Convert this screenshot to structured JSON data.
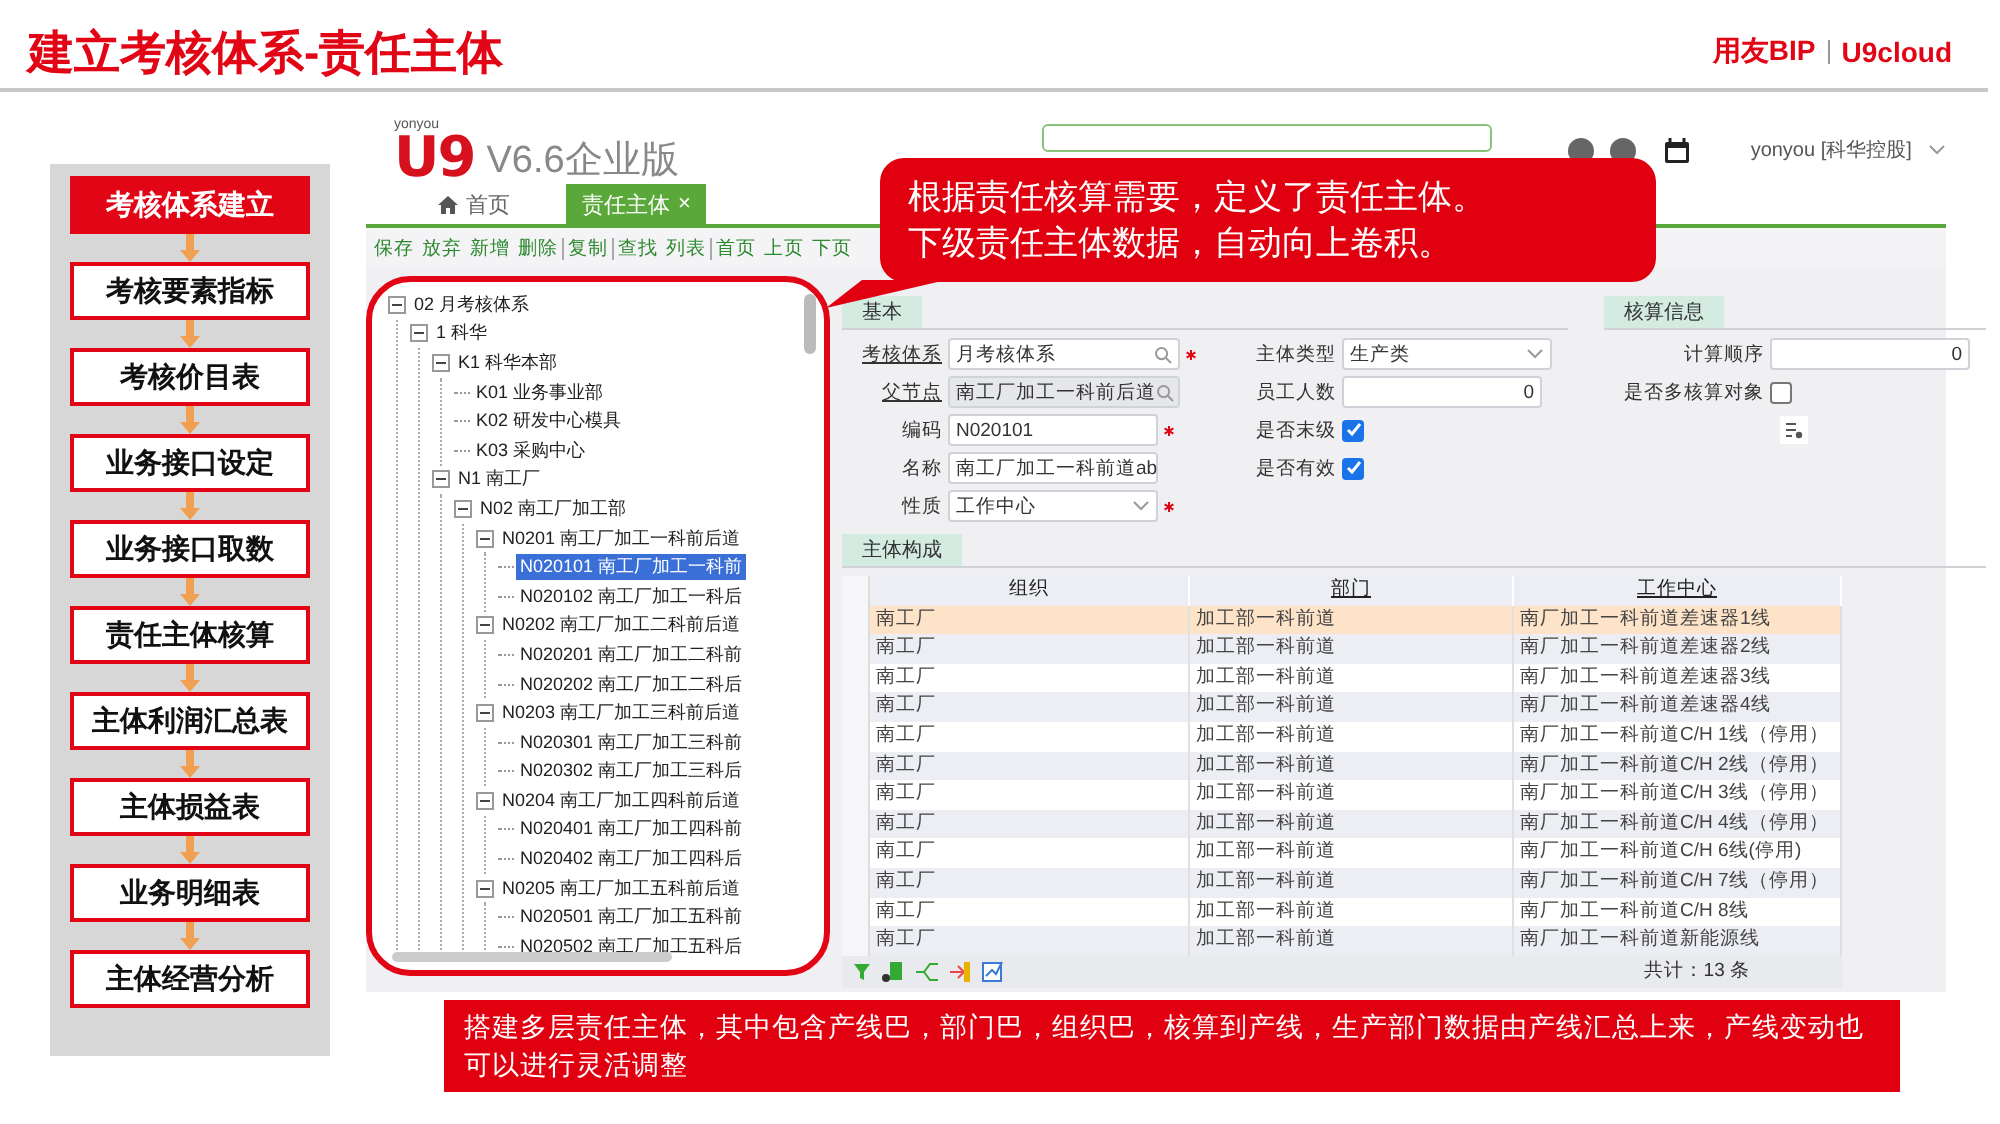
{
  "slide": {
    "title": "建立考核体系-责任主体",
    "brand": {
      "name": "用友BIP",
      "product": "U9cloud"
    }
  },
  "steps": [
    {
      "label": "考核体系建立",
      "selected": true
    },
    {
      "label": "考核要素指标",
      "selected": false
    },
    {
      "label": "考核价目表",
      "selected": false
    },
    {
      "label": "业务接口设定",
      "selected": false
    },
    {
      "label": "业务接口取数",
      "selected": false
    },
    {
      "label": "责任主体核算",
      "selected": false
    },
    {
      "label": "主体利润汇总表",
      "selected": false
    },
    {
      "label": "主体损益表",
      "selected": false
    },
    {
      "label": "业务明细表",
      "selected": false
    },
    {
      "label": "主体经营分析",
      "selected": false
    }
  ],
  "app": {
    "logo": {
      "vendor": "yonyou",
      "mark": "U9",
      "edition": "V6.6企业版"
    },
    "user": "yonyou [科华控股]",
    "tabs": [
      {
        "label": "首页",
        "kind": "home",
        "selected": false
      },
      {
        "label": "责任主体",
        "kind": "doc",
        "selected": true,
        "close": "×"
      }
    ],
    "toolbar": [
      [
        "保存",
        "放弃",
        "新增",
        "删除"
      ],
      [
        "复制"
      ],
      [
        "查找",
        "列表"
      ],
      [
        "首页",
        "上页",
        "下页"
      ]
    ],
    "tree": [
      {
        "label": "02 月考核体系",
        "expanded": true,
        "selected": false,
        "children": [
          {
            "label": "1 科华",
            "expanded": true,
            "selected": false,
            "children": [
              {
                "label": "K1 科华本部",
                "expanded": true,
                "selected": false,
                "children": [
                  {
                    "label": "K01 业务事业部",
                    "selected": false
                  },
                  {
                    "label": "K02 研发中心模具",
                    "selected": false
                  },
                  {
                    "label": "K03 采购中心",
                    "selected": false
                  }
                ]
              },
              {
                "label": "N1 南工厂",
                "expanded": true,
                "selected": false,
                "children": [
                  {
                    "label": "N02 南工厂加工部",
                    "expanded": true,
                    "selected": false,
                    "children": [
                      {
                        "label": "N0201 南工厂加工一科前后道",
                        "expanded": true,
                        "selected": false,
                        "children": [
                          {
                            "label": "N020101 南工厂加工一科前",
                            "selected": true
                          },
                          {
                            "label": "N020102 南工厂加工一科后",
                            "selected": false
                          }
                        ]
                      },
                      {
                        "label": "N0202 南工厂加工二科前后道",
                        "expanded": true,
                        "selected": false,
                        "children": [
                          {
                            "label": "N020201 南工厂加工二科前",
                            "selected": false
                          },
                          {
                            "label": "N020202 南工厂加工二科后",
                            "selected": false
                          }
                        ]
                      },
                      {
                        "label": "N0203 南工厂加工三科前后道",
                        "expanded": true,
                        "selected": false,
                        "children": [
                          {
                            "label": "N020301 南工厂加工三科前",
                            "selected": false
                          },
                          {
                            "label": "N020302 南工厂加工三科后",
                            "selected": false
                          }
                        ]
                      },
                      {
                        "label": "N0204 南工厂加工四科前后道",
                        "expanded": true,
                        "selected": false,
                        "children": [
                          {
                            "label": "N020401 南工厂加工四科前",
                            "selected": false
                          },
                          {
                            "label": "N020402 南工厂加工四科后",
                            "selected": false
                          }
                        ]
                      },
                      {
                        "label": "N0205 南工厂加工五科前后道",
                        "expanded": true,
                        "selected": false,
                        "children": [
                          {
                            "label": "N020501 南工厂加工五科前",
                            "selected": false
                          },
                          {
                            "label": "N020502 南工厂加工五科后",
                            "selected": false
                          }
                        ]
                      }
                    ]
                  }
                ]
              }
            ]
          }
        ]
      }
    ],
    "form": {
      "sections": [
        {
          "title": "基本",
          "columns": [
            [
              {
                "label": "考核体系",
                "kind": "lookup",
                "value": "月考核体系",
                "link": true,
                "required": true,
                "disabled": false
              },
              {
                "label": "父节点",
                "kind": "lookup",
                "value": "南工厂加工一科前后道",
                "link": true,
                "required": false,
                "disabled": true
              },
              {
                "label": "编码",
                "kind": "text",
                "value": "N020101",
                "link": false,
                "required": true,
                "disabled": false
              },
              {
                "label": "名称",
                "kind": "text",
                "value": "南工厂加工一科前道",
                "suffix": "ab",
                "link": false,
                "required": false,
                "disabled": false
              },
              {
                "label": "性质",
                "kind": "select",
                "value": "工作中心",
                "link": false,
                "required": true,
                "disabled": false
              }
            ],
            [
              {
                "label": "主体类型",
                "kind": "select",
                "value": "生产类",
                "link": false,
                "required": false,
                "disabled": false
              },
              {
                "label": "员工人数",
                "kind": "number",
                "value": "0",
                "link": false,
                "required": false,
                "disabled": false
              },
              {
                "label": "是否末级",
                "kind": "checkbox",
                "checked": true
              },
              {
                "label": "是否有效",
                "kind": "checkbox",
                "checked": true
              }
            ]
          ]
        },
        {
          "title": "核算信息",
          "columns": [
            [
              {
                "label": "计算顺序",
                "kind": "number",
                "value": "0",
                "link": false,
                "required": false,
                "disabled": false
              },
              {
                "label": "是否多核算对象",
                "kind": "checkbox",
                "checked": false
              },
              {
                "kind": "tool"
              }
            ]
          ]
        }
      ]
    },
    "grid": {
      "title": "主体构成",
      "columns": [
        {
          "label": "组织",
          "underlined": false
        },
        {
          "label": "部门",
          "underlined": true
        },
        {
          "label": "工作中心",
          "underlined": true
        }
      ],
      "rows": [
        {
          "cells": [
            "南工厂",
            "加工部一科前道",
            "南厂加工一科前道差速器1线"
          ],
          "selected": true
        },
        {
          "cells": [
            "南工厂",
            "加工部一科前道",
            "南厂加工一科前道差速器2线"
          ],
          "selected": false
        },
        {
          "cells": [
            "南工厂",
            "加工部一科前道",
            "南厂加工一科前道差速器3线"
          ],
          "selected": false
        },
        {
          "cells": [
            "南工厂",
            "加工部一科前道",
            "南厂加工一科前道差速器4线"
          ],
          "selected": false
        },
        {
          "cells": [
            "南工厂",
            "加工部一科前道",
            "南厂加工一科前道C/H 1线（停用）"
          ],
          "selected": false
        },
        {
          "cells": [
            "南工厂",
            "加工部一科前道",
            "南厂加工一科前道C/H 2线（停用）"
          ],
          "selected": false
        },
        {
          "cells": [
            "南工厂",
            "加工部一科前道",
            "南厂加工一科前道C/H 3线（停用）"
          ],
          "selected": false
        },
        {
          "cells": [
            "南工厂",
            "加工部一科前道",
            "南厂加工一科前道C/H 4线（停用）"
          ],
          "selected": false
        },
        {
          "cells": [
            "南工厂",
            "加工部一科前道",
            "南厂加工一科前道C/H 6线(停用)"
          ],
          "selected": false
        },
        {
          "cells": [
            "南工厂",
            "加工部一科前道",
            "南厂加工一科前道C/H 7线（停用）"
          ],
          "selected": false
        },
        {
          "cells": [
            "南工厂",
            "加工部一科前道",
            "南厂加工一科前道C/H 8线"
          ],
          "selected": false
        },
        {
          "cells": [
            "南工厂",
            "加工部一科前道",
            "南厂加工一科前道新能源线"
          ],
          "selected": false
        }
      ],
      "total": "共计：13 条"
    }
  },
  "callouts": {
    "top": [
      "根据责任核算需要，定义了责任主体。",
      "下级责任主体数据，自动向上卷积。"
    ],
    "bottom": "搭建多层责任主体，其中包含产线巴，部门巴，组织巴，核算到产线，生产部门数据由产线汇总上来，产线变动也可以进行灵活调整"
  }
}
